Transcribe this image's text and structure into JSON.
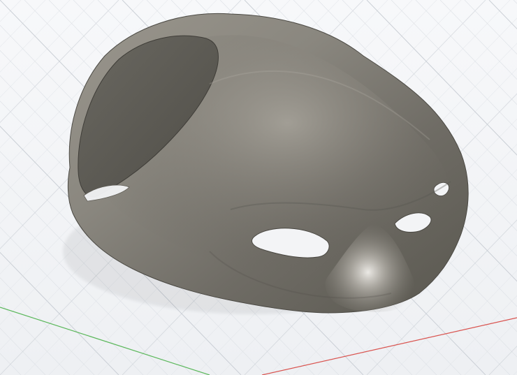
{
  "viewport": {
    "background": "#f3f4f6",
    "grid_color": "#c7ccd3",
    "grid_minor_color": "#dde1e6",
    "axis_x_color": "#d9534f",
    "axis_y_color": "#5cb85c"
  },
  "model": {
    "object": "mask-shell",
    "material_color": "#7a776f",
    "highlight_color": "#f2f0ec",
    "shadow_color": "#4f4d47"
  }
}
